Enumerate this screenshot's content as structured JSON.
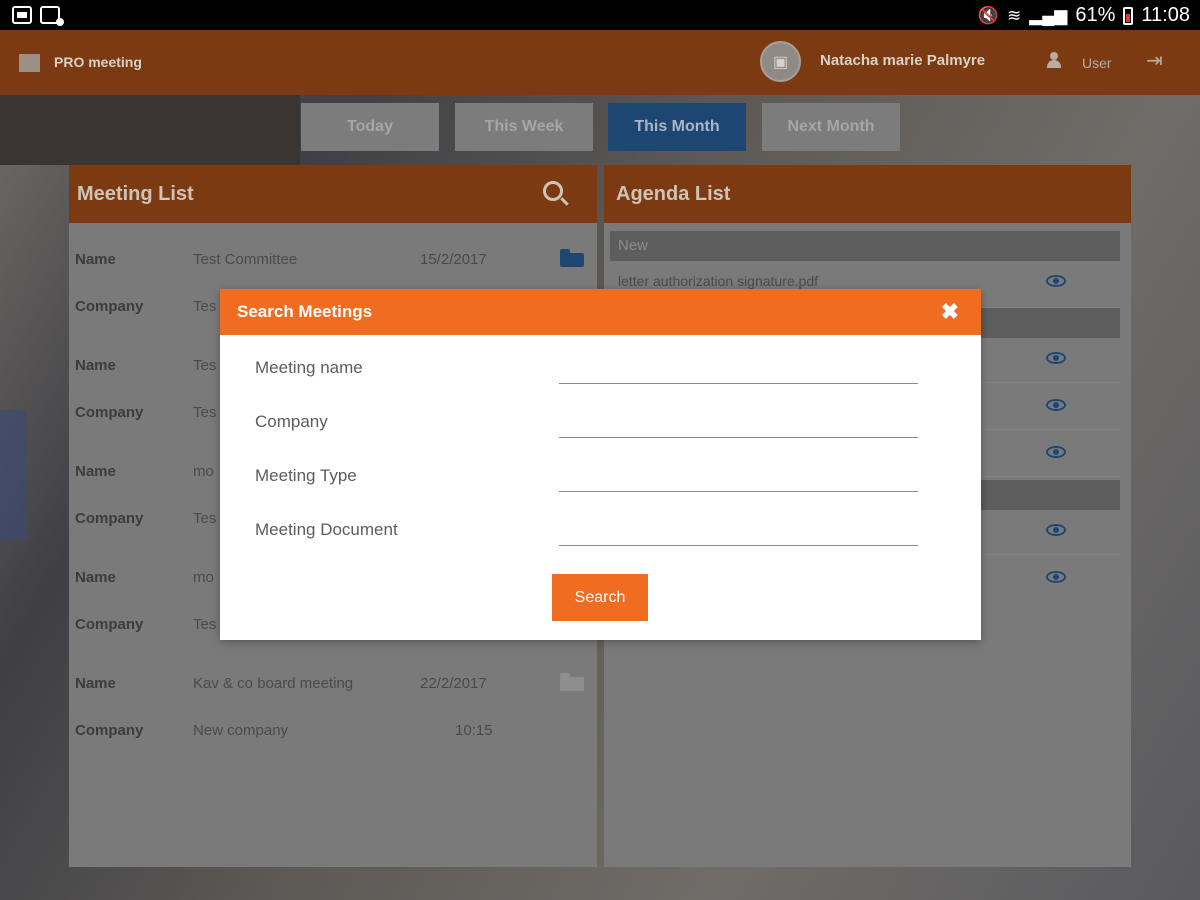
{
  "status_bar": {
    "battery": "61%",
    "time": "11:08"
  },
  "app_bar": {
    "title": "PRO meeting",
    "user_name": "Natacha marie Palmyre",
    "role": "User"
  },
  "tabs": [
    {
      "label": "Today"
    },
    {
      "label": "This Week"
    },
    {
      "label": "This Month"
    },
    {
      "label": "Next Month"
    }
  ],
  "meeting_list": {
    "title": "Meeting List",
    "name_label": "Name",
    "company_label": "Company",
    "items": [
      {
        "name": "Test Committee",
        "date": "15/2/2017",
        "company": "Tes"
      },
      {
        "name": "Tes",
        "company": "Tes"
      },
      {
        "name": "mo",
        "company": "Tes"
      },
      {
        "name": "mo",
        "company": "Tes"
      },
      {
        "name": "Kav & co board meeting",
        "date": "22/2/2017",
        "company": "New company",
        "time": "10:15"
      }
    ]
  },
  "agenda_list": {
    "title": "Agenda List",
    "section_new": "New",
    "first_item": "letter authorization signature.pdf"
  },
  "modal": {
    "title": "Search Meetings",
    "fields": [
      {
        "label": "Meeting name",
        "value": ""
      },
      {
        "label": "Company",
        "value": ""
      },
      {
        "label": "Meeting Type",
        "value": ""
      },
      {
        "label": "Meeting Document",
        "value": ""
      }
    ],
    "search_label": "Search"
  },
  "colors": {
    "accent": "#ef6c21",
    "appbar": "#7b3a12",
    "active_tab": "#1e4673"
  }
}
